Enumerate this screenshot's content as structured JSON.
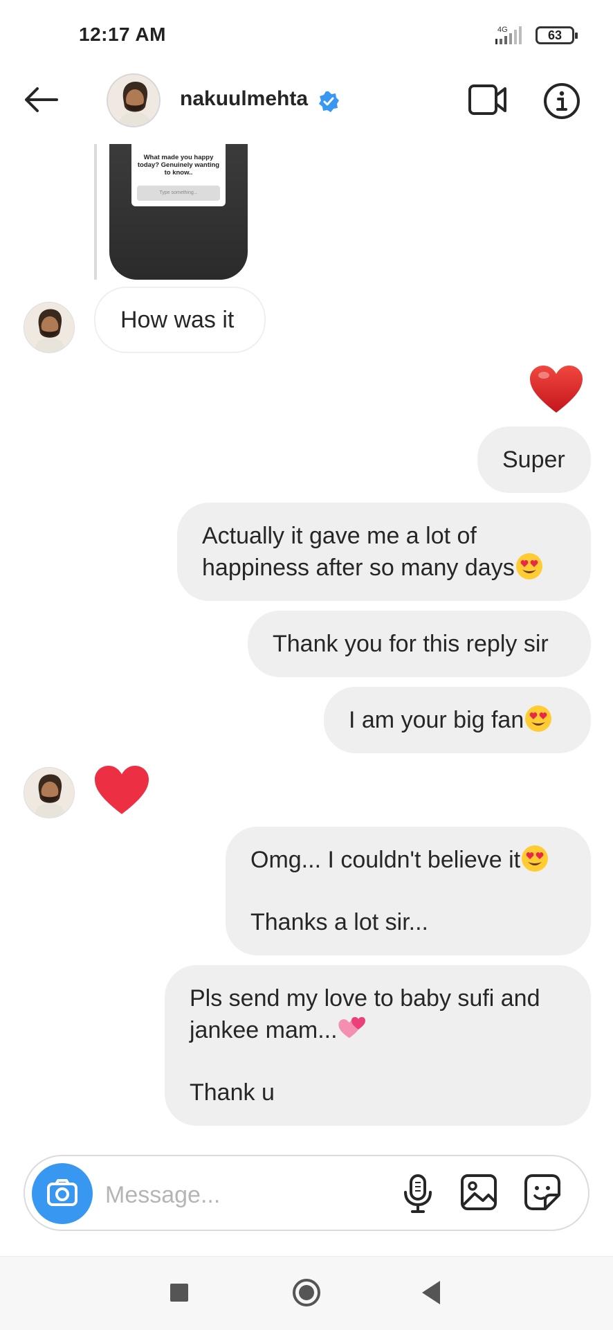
{
  "status_bar": {
    "time": "12:17 AM",
    "network": "4G",
    "battery": "63"
  },
  "header": {
    "username": "nakuulmehta",
    "verified": true,
    "icons": [
      "back-arrow-icon",
      "video-call-icon",
      "info-icon"
    ]
  },
  "story_reply": {
    "question": "What made you happy today? Genuinely wanting to know..",
    "input_placeholder": "Type something..."
  },
  "messages": [
    {
      "from": "them",
      "text": "How was it"
    },
    {
      "from": "me",
      "type": "reaction",
      "icon": "red-heart-icon"
    },
    {
      "from": "me",
      "text": "Super"
    },
    {
      "from": "me",
      "lines": [
        "Actually it gave me a lot of",
        "happiness after so many days"
      ],
      "emoji": "heart-eyes"
    },
    {
      "from": "me",
      "text": "Thank you for this reply sir"
    },
    {
      "from": "me",
      "text": "I am your big fan",
      "emoji": "heart-eyes"
    },
    {
      "from": "them",
      "type": "reaction",
      "icon": "red-heart-icon"
    },
    {
      "from": "me",
      "lines": [
        "Omg... I couldn't believe it",
        "",
        "Thanks a lot sir..."
      ],
      "emoji": "heart-eyes"
    },
    {
      "from": "me",
      "lines": [
        "Pls send my love to baby sufi and",
        "jankee mam...",
        "",
        "Thank u"
      ],
      "emoji": "two-hearts"
    }
  ],
  "composer": {
    "placeholder": "Message...",
    "icons": [
      "camera-icon",
      "microphone-icon",
      "gallery-icon",
      "sticker-icon"
    ]
  },
  "colors": {
    "accent_blue": "#3897f0",
    "verified_blue": "#3897f0",
    "outgoing_bubble": "#efefef",
    "heart_red": "#ed2f43"
  }
}
